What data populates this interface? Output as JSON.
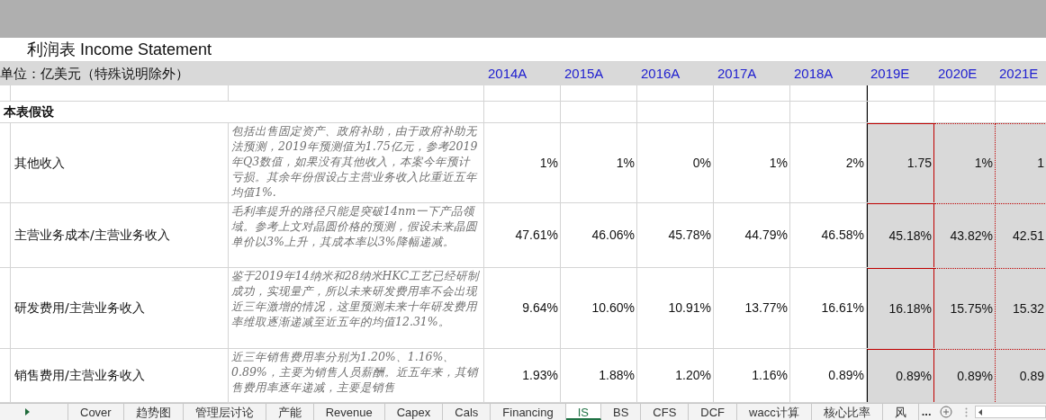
{
  "title": "利润表 Income Statement",
  "unit": "单位：亿美元（特殊说明除外）",
  "years": [
    {
      "label": "2014A",
      "kind": "actual"
    },
    {
      "label": "2015A",
      "kind": "actual"
    },
    {
      "label": "2016A",
      "kind": "actual"
    },
    {
      "label": "2017A",
      "kind": "actual"
    },
    {
      "label": "2018A",
      "kind": "actual"
    },
    {
      "label": "2019E",
      "kind": "estimate"
    },
    {
      "label": "2020E",
      "kind": "estimate"
    },
    {
      "label": "2021E",
      "kind": "estimate"
    }
  ],
  "section": "本表假设",
  "rows": [
    {
      "label": "其他收入",
      "note": "包括出售固定资产、政府补助，由于政府补助无法预测，2019年预测值为1.75亿元，参考2019年Q3数值，如果没有其他收入，本案今年预计亏损。其余年份假设占主营业务收入比重近五年均值1%.",
      "values": [
        "1%",
        "1%",
        "0%",
        "1%",
        "2%",
        "1.75",
        "1%",
        "1"
      ]
    },
    {
      "label": "主营业务成本/主营业务收入",
      "note": "毛利率提升的路径只能是突破14nm一下产品领域。参考上文对晶圆价格的预测，假设未来晶圆单价以3%上升，其成本率以3%降幅递减。",
      "values": [
        "47.61%",
        "46.06%",
        "45.78%",
        "44.79%",
        "46.58%",
        "45.18%",
        "43.82%",
        "42.51"
      ]
    },
    {
      "label": "研发费用/主营业务收入",
      "note": "鉴于2019年14纳米和28纳米HKC工艺已经研制成功，实现量产，所以未来研发费用率不会出现近三年激增的情况，这里预测未来十年研发费用率维取逐渐递减至近五年的均值12.31%。",
      "values": [
        "9.64%",
        "10.60%",
        "10.91%",
        "13.77%",
        "16.61%",
        "16.18%",
        "15.75%",
        "15.32"
      ]
    },
    {
      "label": "销售费用/主营业务收入",
      "note": "近三年销售费用率分别为1.20%、1.16%、0.89%，主要为销售人员薪酬。近五年来，其销售费用率逐年递减，主要是销售",
      "values": [
        "1.93%",
        "1.88%",
        "1.20%",
        "1.16%",
        "0.89%",
        "0.89%",
        "0.89%",
        "0.89"
      ]
    }
  ],
  "sheet_tabs": [
    {
      "label": "Cover",
      "selected": false
    },
    {
      "label": "趋势图",
      "selected": false
    },
    {
      "label": "管理层讨论",
      "selected": false
    },
    {
      "label": "产能",
      "selected": false
    },
    {
      "label": "Revenue",
      "selected": false
    },
    {
      "label": "Capex",
      "selected": false
    },
    {
      "label": "Cals",
      "selected": false
    },
    {
      "label": "Financing",
      "selected": false
    },
    {
      "label": "IS",
      "selected": true
    },
    {
      "label": "BS",
      "selected": false
    },
    {
      "label": "CFS",
      "selected": false
    },
    {
      "label": "DCF",
      "selected": false
    },
    {
      "label": "wacc计算",
      "selected": false
    },
    {
      "label": "核心比率",
      "selected": false
    },
    {
      "label": "风",
      "selected": false
    }
  ],
  "more_tabs": "..."
}
